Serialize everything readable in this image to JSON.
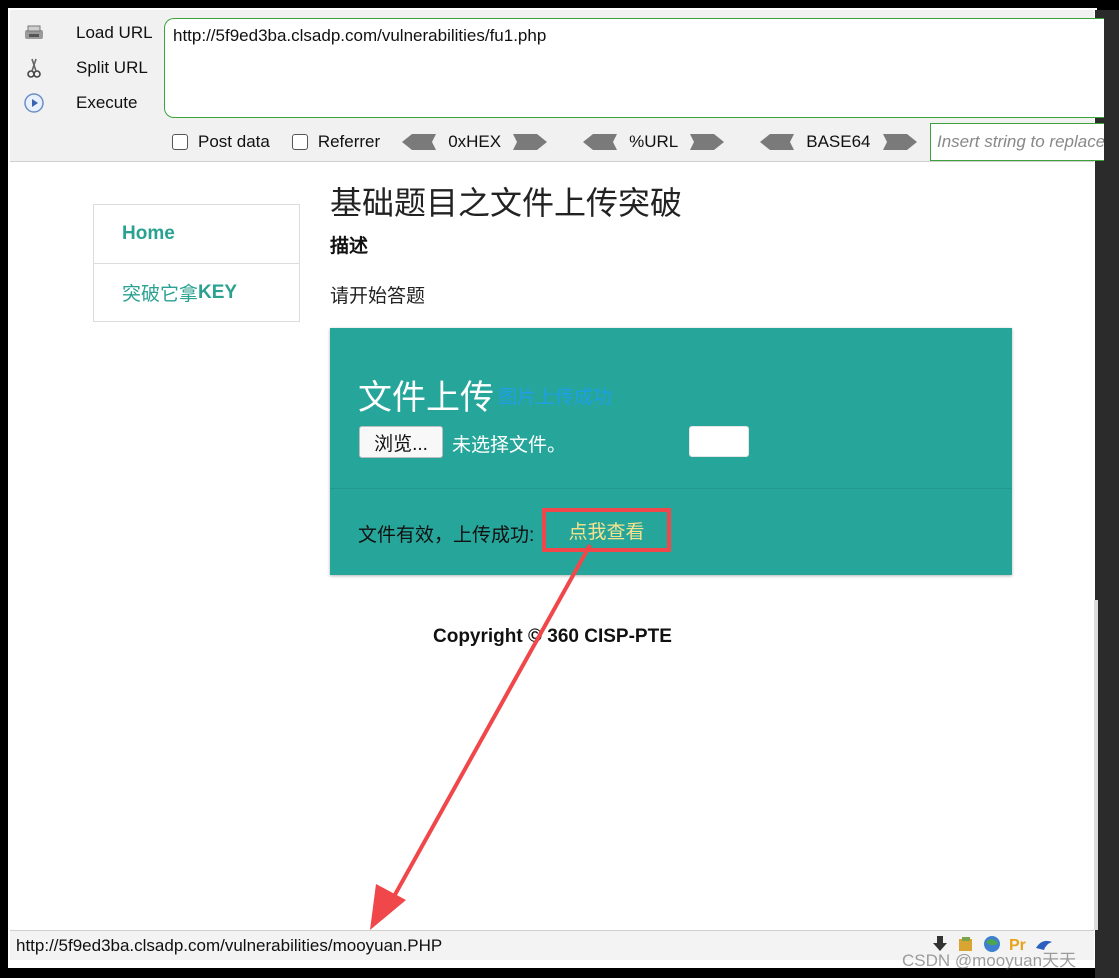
{
  "hackbar": {
    "load_url": "Load URL",
    "split_url": "Split URL",
    "execute": "Execute",
    "url_value": "http://5f9ed3ba.clsadp.com/vulnerabilities/fu1.php",
    "post_data": "Post data",
    "referrer": "Referrer",
    "hex": "0xHEX",
    "url_enc": "%URL",
    "base64": "BASE64",
    "replace_placeholder": "Insert string to replace"
  },
  "nav": {
    "home": "Home",
    "item2_cn": "突破它拿",
    "item2_en": "KEY"
  },
  "page": {
    "title": "基础题目之文件上传突破",
    "desc_heading": "描述",
    "desc_text": "请开始答题"
  },
  "upload_panel": {
    "title": "文件上传",
    "status": "图片上传成功",
    "browse": "浏览...",
    "no_file": "未选择文件。",
    "result": "文件有效，上传成功:",
    "view_link": "点我查看"
  },
  "footer": {
    "copyright": "Copyright © 360 CISP-PTE"
  },
  "statusbar": {
    "link_url": "http://5f9ed3ba.clsadp.com/vulnerabilities/mooyuan.PHP"
  },
  "watermark": "CSDN @mooyuan天天",
  "colors": {
    "accent": "#26a69a",
    "nav_text": "#2aa191",
    "highlight": "#f0474a",
    "link_yellow": "#f7e28e",
    "status_blue": "#1e9fe6"
  }
}
